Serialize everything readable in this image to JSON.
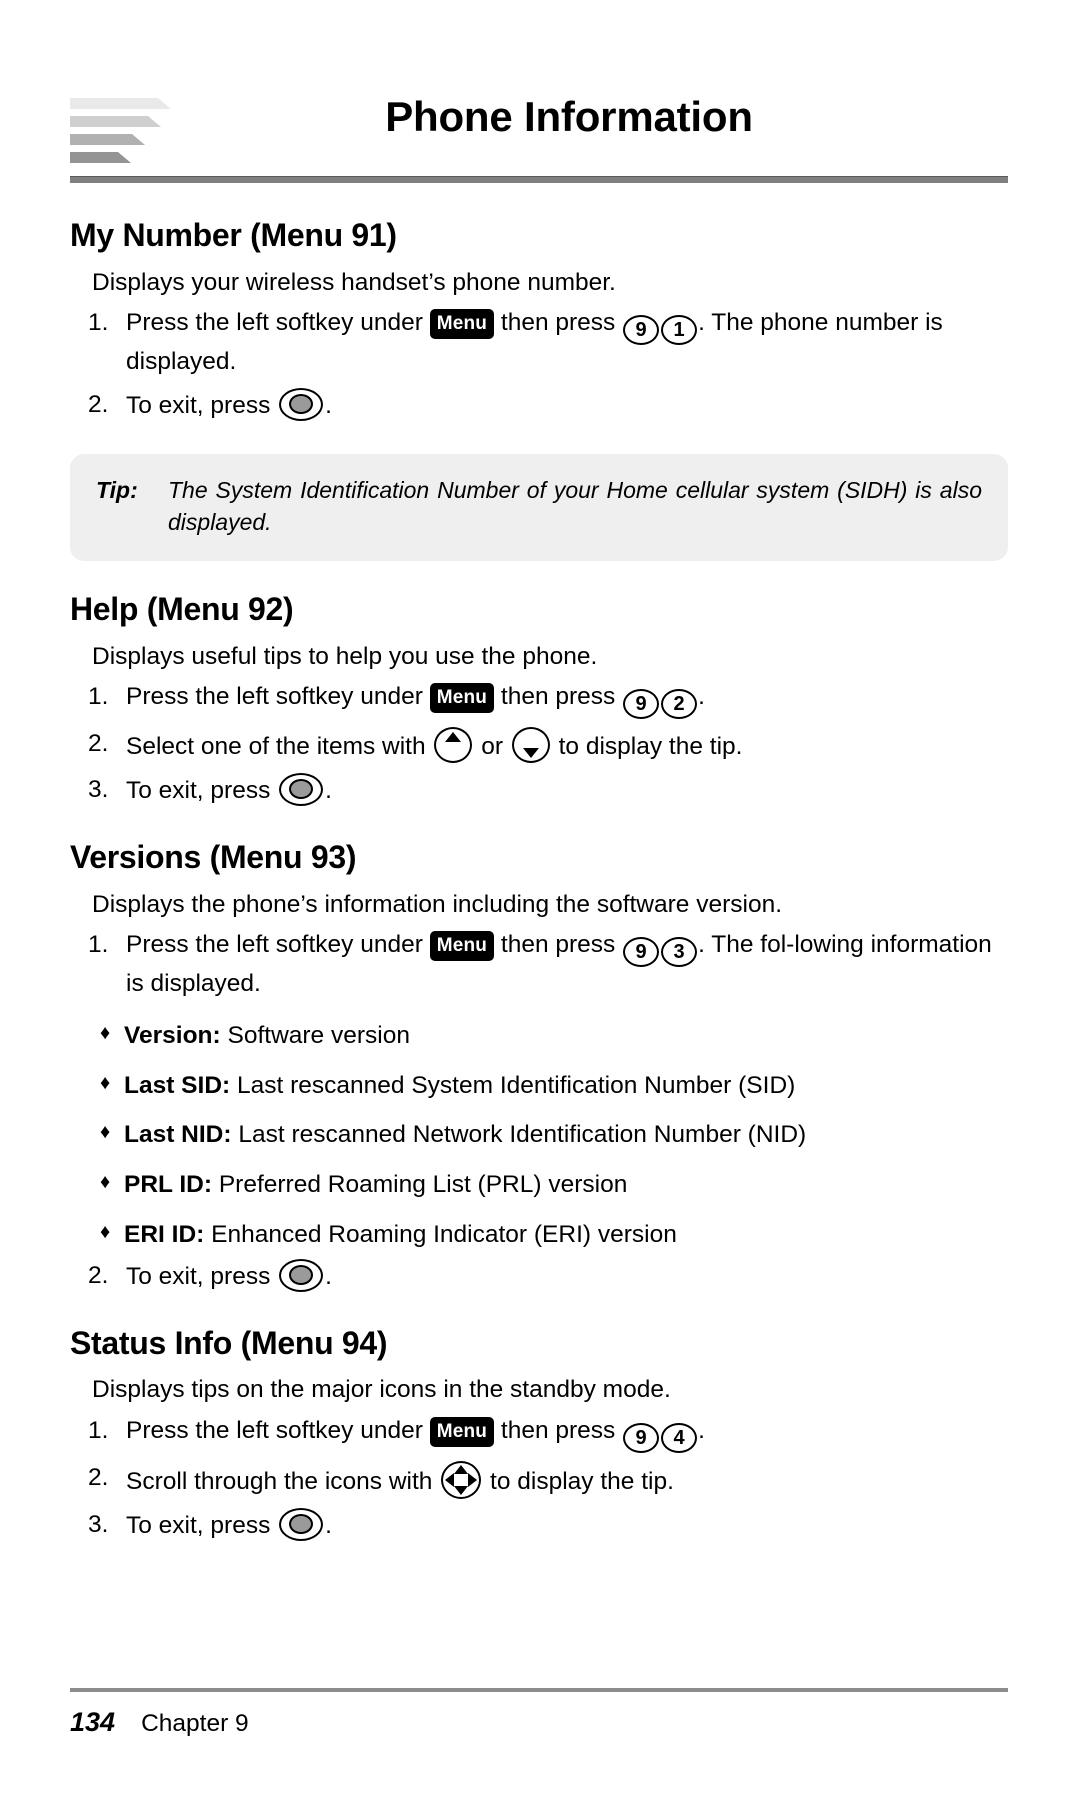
{
  "header": {
    "title": "Phone Information",
    "logo_icon": "stacked-bars-logo"
  },
  "sections": [
    {
      "id": "my-number",
      "title": "My Number (Menu 91)",
      "intro": "Displays your wireless handset’s phone number.",
      "steps": [
        {
          "num": "1.",
          "parts": [
            {
              "t": "text",
              "v": "Press the left softkey under "
            },
            {
              "t": "key-menu",
              "v": "Menu"
            },
            {
              "t": "text",
              "v": " then press "
            },
            {
              "t": "key-num",
              "v": "9"
            },
            {
              "t": "key-num",
              "v": "1"
            },
            {
              "t": "text",
              "v": ". The phone number is displayed."
            }
          ]
        },
        {
          "num": "2.",
          "parts": [
            {
              "t": "text",
              "v": "To exit, press "
            },
            {
              "t": "key-end",
              "v": "end-key"
            },
            {
              "t": "text",
              "v": "."
            }
          ]
        }
      ]
    },
    {
      "id": "help",
      "title": "Help (Menu 92)",
      "intro": "Displays useful tips to help you use the phone.",
      "steps": [
        {
          "num": "1.",
          "parts": [
            {
              "t": "text",
              "v": "Press the left softkey under "
            },
            {
              "t": "key-menu",
              "v": "Menu"
            },
            {
              "t": "text",
              "v": " then press "
            },
            {
              "t": "key-num",
              "v": "9"
            },
            {
              "t": "key-num",
              "v": "2"
            },
            {
              "t": "text",
              "v": "."
            }
          ]
        },
        {
          "num": "2.",
          "parts": [
            {
              "t": "text",
              "v": "Select one of the items with "
            },
            {
              "t": "key-up",
              "v": "up-arrow-key"
            },
            {
              "t": "text",
              "v": " or "
            },
            {
              "t": "key-down",
              "v": "down-arrow-key"
            },
            {
              "t": "text",
              "v": " to display the tip."
            }
          ]
        },
        {
          "num": "3.",
          "parts": [
            {
              "t": "text",
              "v": "To exit, press "
            },
            {
              "t": "key-end",
              "v": "end-key"
            },
            {
              "t": "text",
              "v": "."
            }
          ]
        }
      ]
    },
    {
      "id": "versions",
      "title": "Versions (Menu 93)",
      "intro": "Displays the phone’s information including the software version.",
      "steps": [
        {
          "num": "1.",
          "parts": [
            {
              "t": "text",
              "v": "Press the left softkey under "
            },
            {
              "t": "key-menu",
              "v": "Menu"
            },
            {
              "t": "text",
              "v": " then press "
            },
            {
              "t": "key-num",
              "v": "9"
            },
            {
              "t": "key-num",
              "v": "3"
            },
            {
              "t": "text",
              "v": ". The fol-lowing information is displayed."
            }
          ]
        }
      ],
      "bullets": [
        {
          "bullet": "♦",
          "term": "Version:",
          "desc": " Software version"
        },
        {
          "bullet": "♦",
          "term": "Last SID:",
          "desc": " Last rescanned System Identification Number (SID)"
        },
        {
          "bullet": "♦",
          "term": "Last NID:",
          "desc": " Last rescanned Network Identification Number (NID)"
        },
        {
          "bullet": "♦",
          "term": "PRL ID:",
          "desc": " Preferred Roaming List (PRL) version"
        },
        {
          "bullet": "♦",
          "term": "ERI ID:",
          "desc": " Enhanced Roaming Indicator (ERI) version"
        }
      ],
      "steps_after": [
        {
          "num": "2.",
          "parts": [
            {
              "t": "text",
              "v": "To exit, press "
            },
            {
              "t": "key-end",
              "v": "end-key"
            },
            {
              "t": "text",
              "v": "."
            }
          ]
        }
      ]
    },
    {
      "id": "status-info",
      "title": "Status Info (Menu 94)",
      "intro": "Displays tips on the major icons in the standby mode.",
      "steps": [
        {
          "num": "1.",
          "parts": [
            {
              "t": "text",
              "v": "Press the left softkey under "
            },
            {
              "t": "key-menu",
              "v": "Menu"
            },
            {
              "t": "text",
              "v": " then press "
            },
            {
              "t": "key-num",
              "v": "9"
            },
            {
              "t": "key-num",
              "v": "4"
            },
            {
              "t": "text",
              "v": "."
            }
          ]
        },
        {
          "num": "2.",
          "parts": [
            {
              "t": "text",
              "v": "Scroll through the icons with "
            },
            {
              "t": "key-nav",
              "v": "four-way-nav-key"
            },
            {
              "t": "text",
              "v": " to display the tip."
            }
          ]
        },
        {
          "num": "3.",
          "parts": [
            {
              "t": "text",
              "v": "To exit, press "
            },
            {
              "t": "key-end",
              "v": "end-key"
            },
            {
              "t": "text",
              "v": "."
            }
          ]
        }
      ]
    }
  ],
  "tip": {
    "label": "Tip:",
    "text": "The System Identification Number of your Home cellular system (SIDH) is also displayed."
  },
  "footer": {
    "page_number": "134",
    "chapter": "Chapter 9"
  },
  "colors": {
    "rule": "#808080",
    "tip_background": "#efefef",
    "key_fill": "#9a9a9a",
    "text": "#000000"
  }
}
